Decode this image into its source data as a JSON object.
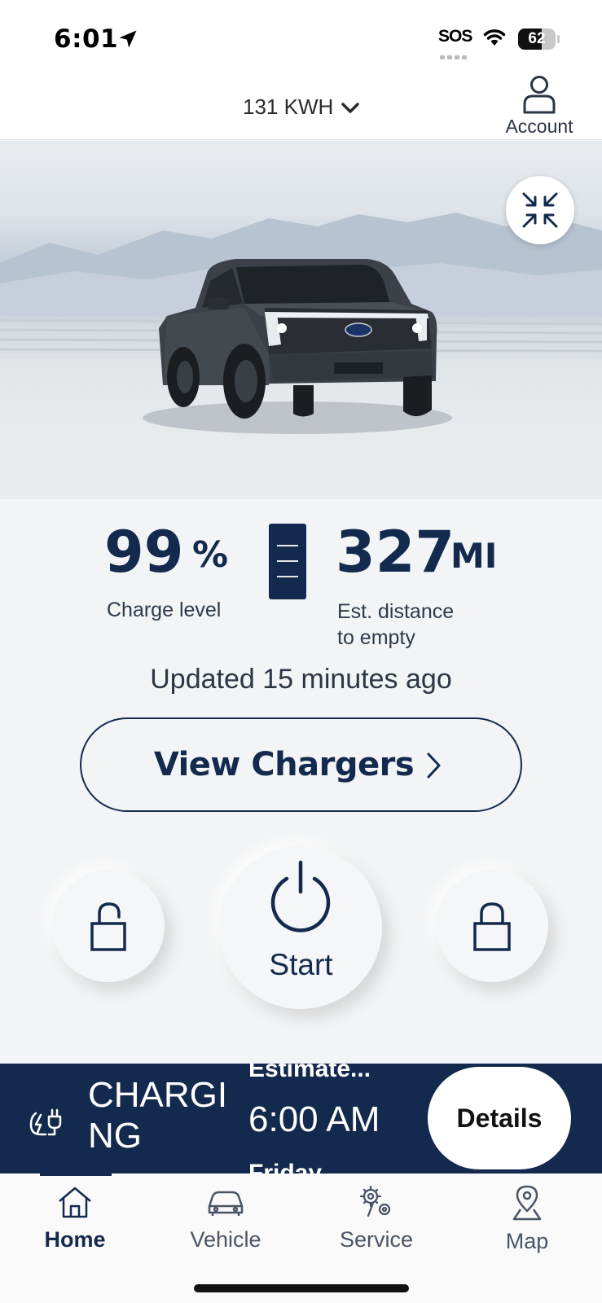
{
  "status_bar": {
    "time": "6:01",
    "sos": "SOS",
    "battery_level": 62,
    "battery_text": "62"
  },
  "header": {
    "vehicle_name": "131 KWH",
    "account_label": "Account"
  },
  "stats": {
    "charge_value": "99",
    "charge_unit": "%",
    "charge_label": "Charge level",
    "distance_value": "327",
    "distance_unit": "MI",
    "distance_label_line1": "Est. distance",
    "distance_label_line2": "to empty",
    "updated_text": "Updated 15 minutes ago"
  },
  "view_chargers_label": "View Chargers",
  "controls": {
    "start_label": "Start"
  },
  "charging_banner": {
    "status": "CHARGING",
    "estimate_label": "Estimate...",
    "estimate_time": "6:00 AM",
    "estimate_day": "Friday",
    "details_label": "Details"
  },
  "tabs": [
    {
      "label": "Home",
      "icon": "home-icon",
      "active": true
    },
    {
      "label": "Vehicle",
      "icon": "car-icon",
      "active": false
    },
    {
      "label": "Service",
      "icon": "service-icon",
      "active": false
    },
    {
      "label": "Map",
      "icon": "map-pin-icon",
      "active": false
    }
  ],
  "colors": {
    "brand_navy": "#132a4e",
    "background": "#f3f4f5"
  }
}
